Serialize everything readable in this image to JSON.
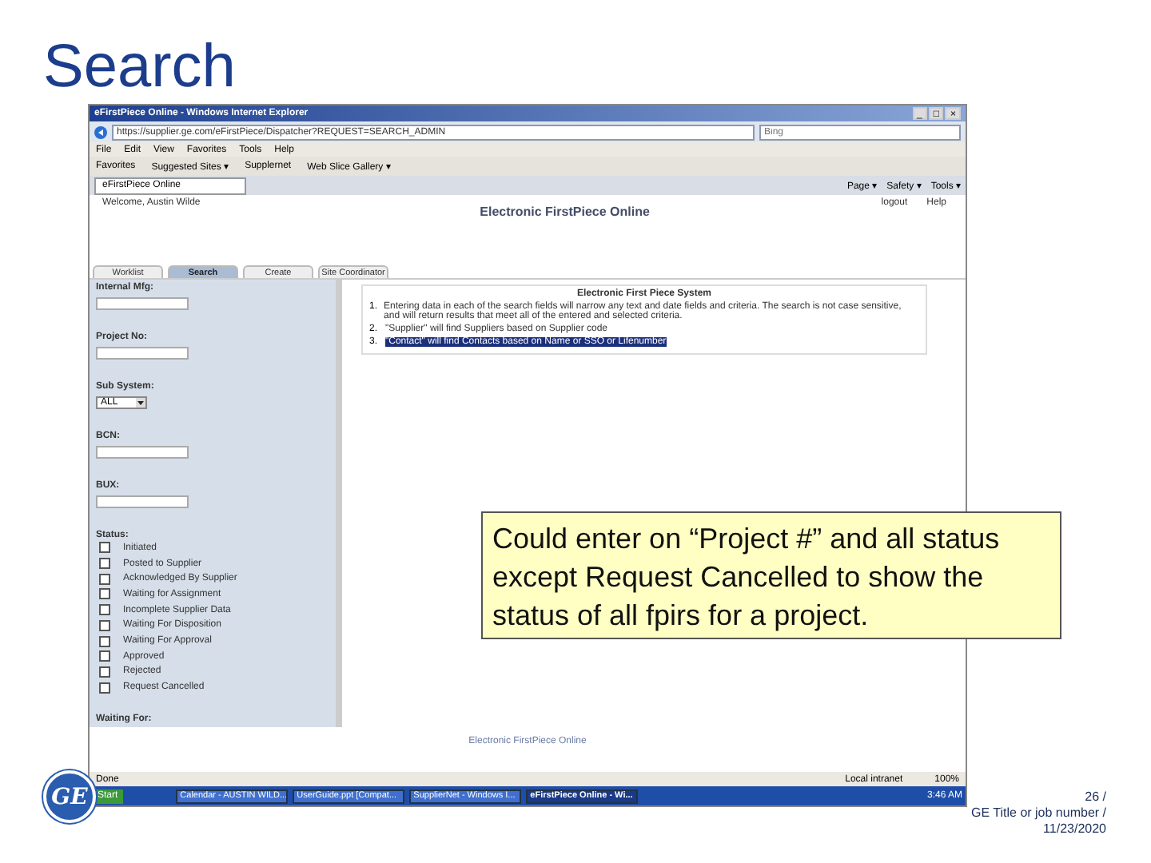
{
  "slide_title": "Search",
  "window": {
    "title": "eFirstPiece Online - Windows Internet Explorer",
    "controls": [
      "_",
      "□",
      "×"
    ]
  },
  "address_bar": {
    "url": "https://supplier.ge.com/eFirstPiece/Dispatcher?REQUEST=SEARCH_ADMIN",
    "search_placeholder": "Bing"
  },
  "menu": [
    "File",
    "Edit",
    "View",
    "Favorites",
    "Tools",
    "Help"
  ],
  "favorites_bar": [
    "Favorites",
    "Suggested Sites ▾",
    "Supplernet",
    "Web Slice Gallery ▾"
  ],
  "browser_tab": "eFirstPiece Online",
  "command_bar": [
    "Page ▾",
    "Safety ▾",
    "Tools ▾"
  ],
  "page": {
    "welcome": "Welcome, Austin Wilde",
    "heading": "Electronic FirstPiece Online",
    "links": [
      "logout",
      "Help"
    ],
    "tabs": [
      {
        "label": "Worklist",
        "selected": false
      },
      {
        "label": "Search",
        "selected": true
      },
      {
        "label": "Create",
        "selected": false
      },
      {
        "label": "Site Coordinator",
        "selected": false
      }
    ],
    "fields": [
      {
        "kind": "text",
        "label": "Internal Mfg:"
      },
      {
        "kind": "text",
        "label": "Project No:"
      },
      {
        "kind": "select",
        "label": "Sub System:",
        "value": "ALL"
      },
      {
        "kind": "text",
        "label": "BCN:"
      },
      {
        "kind": "text",
        "label": "BUX:"
      }
    ],
    "status_label": "Status:",
    "statuses": [
      {
        "label": "Initiated",
        "checked": false
      },
      {
        "label": "Posted to Supplier",
        "checked": false
      },
      {
        "label": "Acknowledged By Supplier",
        "checked": false
      },
      {
        "label": "Waiting for Assignment",
        "checked": false
      },
      {
        "label": "Incomplete Supplier Data",
        "checked": false
      },
      {
        "label": "Waiting For Disposition",
        "checked": false
      },
      {
        "label": "Waiting For Approval",
        "checked": false
      },
      {
        "label": "Approved",
        "checked": false
      },
      {
        "label": "Rejected",
        "checked": false
      },
      {
        "label": "Request Cancelled",
        "checked": false
      }
    ],
    "waiting_label": "Waiting For:",
    "info_title": "Electronic First Piece System",
    "info_items": [
      {
        "num": "1.",
        "text": "Entering data in each of the search fields will narrow any text and date fields and criteria. The search is not case sensitive, and will return results that meet all of the entered and selected criteria.",
        "selected": false
      },
      {
        "num": "2.",
        "text": "\"Supplier\" will find Suppliers based on Supplier code",
        "selected": false
      },
      {
        "num": "3.",
        "text": "\"Contact\" will find Contacts based on Name or SSO or Lifenumber",
        "selected": true
      }
    ],
    "footer": "Electronic FirstPiece Online"
  },
  "status_bar": {
    "text": "Done",
    "zone": "Local intranet",
    "zoom": "100%"
  },
  "taskbar": {
    "start": "Start",
    "items": [
      {
        "label": "Calendar - AUSTIN WILD...",
        "selected": false
      },
      {
        "label": "UserGuide.ppt [Compat...",
        "selected": false
      },
      {
        "label": "SupplierNet - Windows I...",
        "selected": false
      },
      {
        "label": "eFirstPiece Online - Wi...",
        "selected": true
      }
    ],
    "clock": "3:46 AM"
  },
  "callout": "Could enter on “Project #” and all status except Request Cancelled to show the status of all fpirs for a project.",
  "logo": "GE",
  "slide_footer": [
    "26 /",
    "GE Title or job number /",
    "11/23/2020"
  ]
}
